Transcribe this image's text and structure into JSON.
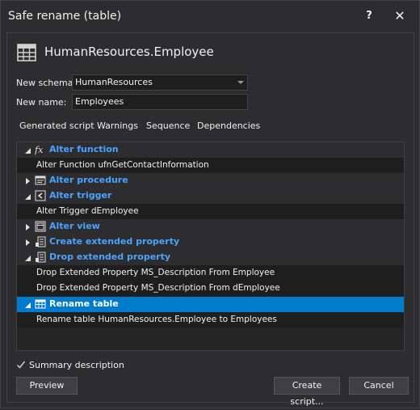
{
  "window": {
    "title": "Safe rename (table)",
    "help": "?",
    "close": "✕"
  },
  "header": {
    "title": "HumanResources.Employee"
  },
  "form": {
    "schema_label": "New schema:",
    "schema_value": "HumanResources",
    "name_label": "New name:",
    "name_value": "Employees"
  },
  "tabs": [
    "Generated script",
    "Warnings",
    "Sequence",
    "Dependencies"
  ],
  "tree": {
    "groups": [
      {
        "label": "Alter function",
        "icon": "function-fx-icon",
        "expanded": true,
        "items": [
          "Alter Function ufnGetContactInformation"
        ]
      },
      {
        "label": "Alter procedure",
        "icon": "procedure-icon",
        "expanded": false,
        "items": []
      },
      {
        "label": "Alter trigger",
        "icon": "trigger-icon",
        "expanded": true,
        "items": [
          "Alter Trigger dEmployee"
        ]
      },
      {
        "label": "Alter view",
        "icon": "view-icon",
        "expanded": false,
        "items": []
      },
      {
        "label": "Create extended property",
        "icon": "extended-property-icon",
        "expanded": false,
        "items": []
      },
      {
        "label": "Drop extended property",
        "icon": "extended-property-icon",
        "expanded": true,
        "items": [
          "Drop Extended Property MS_Description From Employee",
          "Drop Extended Property MS_Description From dEmployee"
        ]
      },
      {
        "label": "Rename table",
        "icon": "table-icon",
        "expanded": true,
        "selected": true,
        "items": [
          "Rename table HumanResources.Employee to Employees"
        ]
      }
    ]
  },
  "summary": {
    "label": "Summary description",
    "checked": true
  },
  "buttons": {
    "preview": "Preview",
    "create_script": "Create script...",
    "cancel": "Cancel"
  },
  "colors": {
    "accent": "#007acc",
    "group_text": "#4aa3ff",
    "background": "#2d2d30"
  }
}
